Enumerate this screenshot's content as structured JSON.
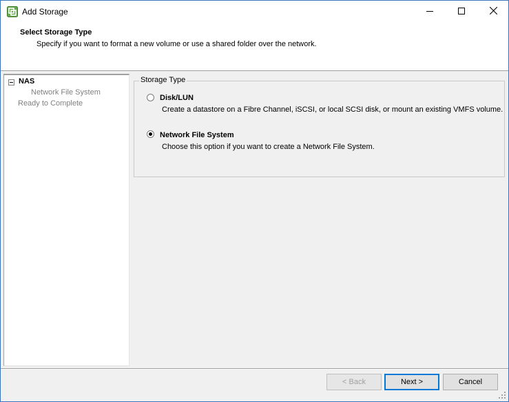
{
  "window": {
    "title": "Add Storage",
    "icon": "vsphere-app-icon",
    "controls": [
      "minimize-icon",
      "maximize-icon",
      "close-icon"
    ]
  },
  "header": {
    "title": "Select Storage Type",
    "subtitle": "Specify if you want to format a new volume or use a shared folder over the network."
  },
  "nav": {
    "items": [
      {
        "label": "NAS",
        "expanded": true
      },
      {
        "label": "Network File System"
      },
      {
        "label": "Ready to Complete"
      }
    ]
  },
  "storage_type": {
    "legend": "Storage Type",
    "options": [
      {
        "label": "Disk/LUN",
        "description": "Create a datastore on a Fibre Channel, iSCSI, or local SCSI disk, or mount an existing VMFS volume.",
        "selected": false
      },
      {
        "label": "Network File System",
        "description": "Choose this option if you want to create a Network File System.",
        "selected": true
      }
    ]
  },
  "footer": {
    "back_label": "< Back",
    "next_label": "Next >",
    "cancel_label": "Cancel"
  },
  "colors": {
    "accent": "#0078d7",
    "window_border": "#3a73b9",
    "dialog_bg": "#f0f0f0",
    "disabled_text": "#a0a0a0"
  }
}
